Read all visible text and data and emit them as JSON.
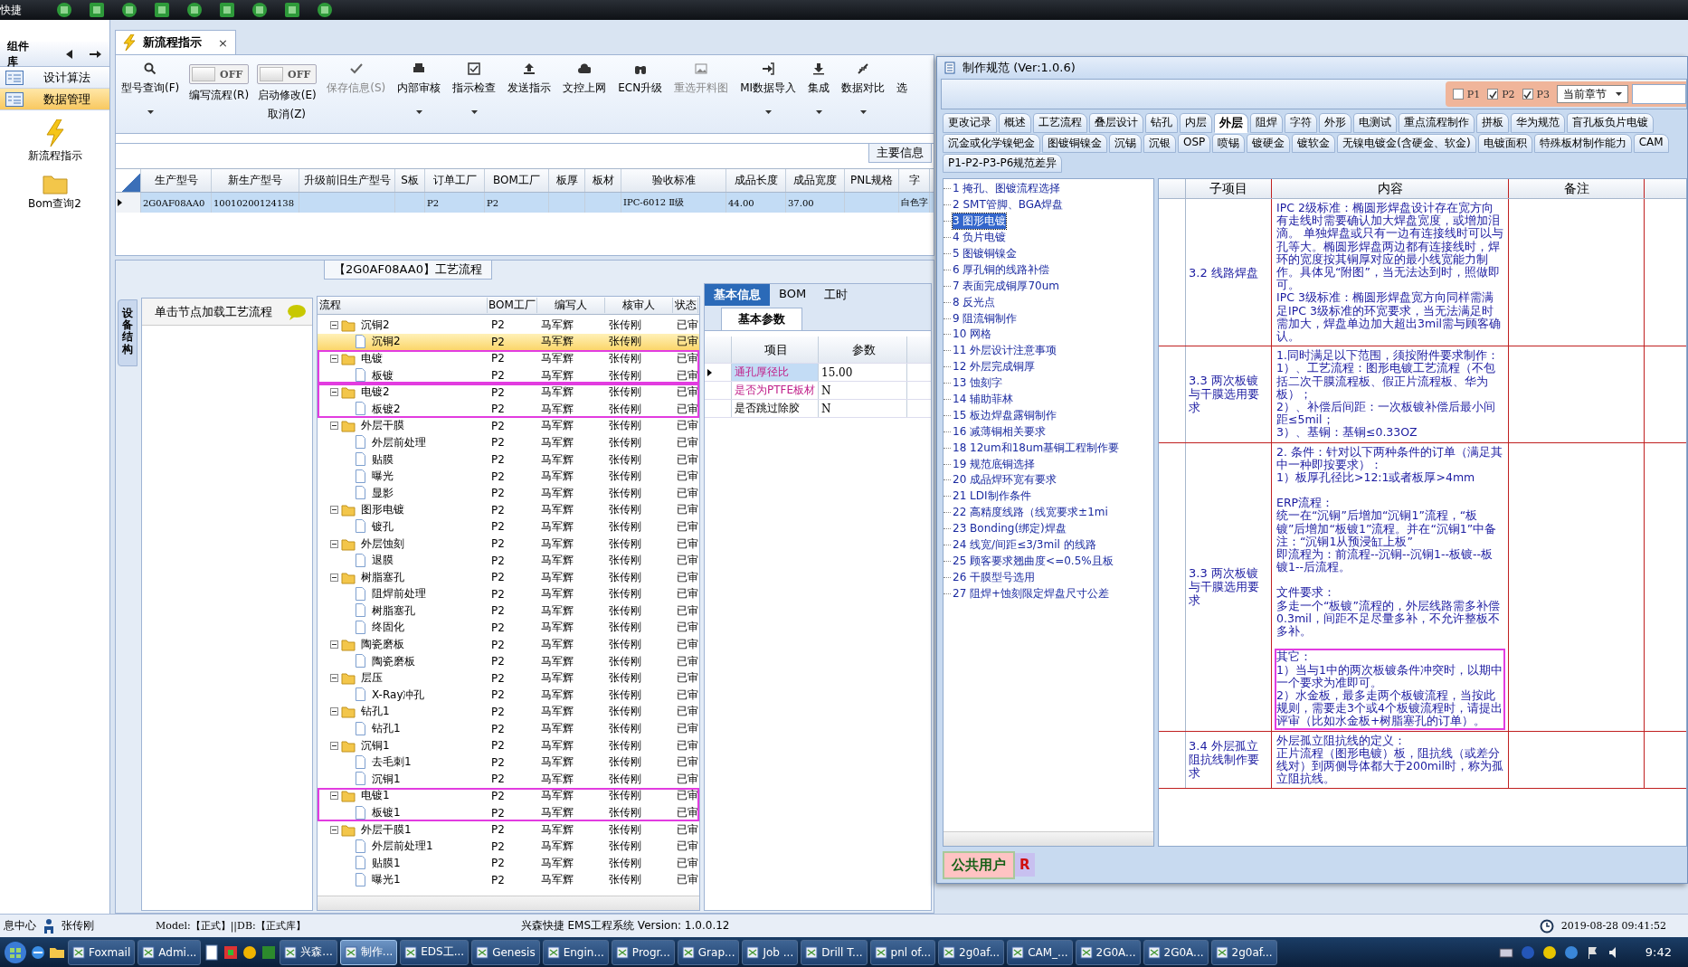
{
  "quickbar": {
    "title": "快捷"
  },
  "leftnav": {
    "title": "组件库",
    "items": [
      {
        "label": "设计算法",
        "selected": false
      },
      {
        "label": "数据管理",
        "selected": true
      }
    ],
    "shortcuts": [
      {
        "label": "新流程指示"
      },
      {
        "label": "Bom查询2"
      }
    ]
  },
  "doc_tab": {
    "label": "新流程指示",
    "selected": true,
    "close": "×"
  },
  "toolbar": [
    {
      "kind": "button",
      "lines": [
        "型号查询(F)"
      ],
      "disabled": false,
      "menu": true
    },
    {
      "kind": "toggle",
      "state_text": "OFF",
      "on": false,
      "lines": [
        "编写流程(R)"
      ]
    },
    {
      "kind": "toggle",
      "state_text": "OFF",
      "on": false,
      "lines": [
        "启动修改(E)",
        "取消(Z)"
      ]
    },
    {
      "kind": "button",
      "lines": [
        "保存信息(S)"
      ],
      "disabled": true,
      "menu": false
    },
    {
      "kind": "button",
      "lines": [
        "内部审核"
      ],
      "disabled": false,
      "menu": true
    },
    {
      "kind": "button",
      "lines": [
        "指示检查"
      ],
      "disabled": false,
      "menu": true
    },
    {
      "kind": "button",
      "lines": [
        "发送指示"
      ],
      "disabled": false,
      "menu": false
    },
    {
      "kind": "button",
      "lines": [
        "文控上网"
      ],
      "disabled": false,
      "menu": false
    },
    {
      "kind": "button",
      "lines": [
        "ECN升级"
      ],
      "disabled": false,
      "menu": false
    },
    {
      "kind": "button",
      "lines": [
        "重选开料图"
      ],
      "disabled": true,
      "menu": false
    },
    {
      "kind": "button",
      "lines": [
        "MI数据导入"
      ],
      "disabled": false,
      "menu": true
    },
    {
      "kind": "button",
      "lines": [
        "集成"
      ],
      "disabled": false,
      "menu": true
    },
    {
      "kind": "button",
      "lines": [
        "数据对比"
      ],
      "disabled": false,
      "menu": true
    },
    {
      "kind": "button",
      "lines": [
        "选"
      ],
      "disabled": false,
      "menu": false
    }
  ],
  "main_grid": {
    "tab": "主要信息",
    "columns": [
      "生产型号",
      "新生产型号",
      "升级前旧生产型号",
      "S板",
      "订单工厂",
      "BOM工厂",
      "板厚",
      "板材",
      "验收标准",
      "成品长度",
      "成品宽度",
      "PNL规格",
      "字"
    ],
    "rows": [
      {
        "selected": true,
        "cells": [
          "2G0AF08AA0",
          "10010200124138",
          "",
          "",
          "P2",
          "P2",
          "",
          "",
          "IPC-6012 Ⅱ级",
          "44.00",
          "37.00",
          "",
          "白色字"
        ]
      }
    ]
  },
  "flow_panel": {
    "title": "【2G0AF08AA0】工艺流程",
    "side_tab": "设备结构",
    "hint": "单击节点加载工艺流程"
  },
  "flow_tree": {
    "columns": [
      "流程",
      "BOM工厂",
      "编写人",
      "核审人",
      "状态"
    ],
    "nodes": [
      {
        "label": "沉铜2",
        "bom": "P2",
        "writer": "马军辉",
        "reviewer": "张传刚",
        "status": "已审",
        "expanded": true,
        "selected": false,
        "highlighted": false,
        "children": [
          {
            "label": "沉铜2",
            "bom": "P2",
            "writer": "马军辉",
            "reviewer": "张传刚",
            "status": "已审",
            "selected": true
          }
        ]
      },
      {
        "label": "电镀",
        "bom": "P2",
        "writer": "马军辉",
        "reviewer": "张传刚",
        "status": "已审",
        "expanded": true,
        "selected": false,
        "highlighted": true,
        "children": [
          {
            "label": "板镀",
            "bom": "P2",
            "writer": "马军辉",
            "reviewer": "张传刚",
            "status": "已审",
            "selected": false
          }
        ]
      },
      {
        "label": "电镀2",
        "bom": "P2",
        "writer": "马军辉",
        "reviewer": "张传刚",
        "status": "已审",
        "expanded": true,
        "selected": false,
        "highlighted": true,
        "children": [
          {
            "label": "板镀2",
            "bom": "P2",
            "writer": "马军辉",
            "reviewer": "张传刚",
            "status": "已审",
            "selected": false
          }
        ]
      },
      {
        "label": "外层干膜",
        "bom": "P2",
        "writer": "马军辉",
        "reviewer": "张传刚",
        "status": "已审",
        "expanded": true,
        "selected": false,
        "highlighted": false,
        "children": [
          {
            "label": "外层前处理",
            "bom": "P2",
            "writer": "马军辉",
            "reviewer": "张传刚",
            "status": "已审",
            "selected": false
          },
          {
            "label": "贴膜",
            "bom": "P2",
            "writer": "马军辉",
            "reviewer": "张传刚",
            "status": "已审",
            "selected": false
          },
          {
            "label": "曝光",
            "bom": "P2",
            "writer": "马军辉",
            "reviewer": "张传刚",
            "status": "已审",
            "selected": false
          },
          {
            "label": "显影",
            "bom": "P2",
            "writer": "马军辉",
            "reviewer": "张传刚",
            "status": "已审",
            "selected": false
          }
        ]
      },
      {
        "label": "图形电镀",
        "bom": "P2",
        "writer": "马军辉",
        "reviewer": "张传刚",
        "status": "已审",
        "expanded": true,
        "selected": false,
        "highlighted": false,
        "children": [
          {
            "label": "镀孔",
            "bom": "P2",
            "writer": "马军辉",
            "reviewer": "张传刚",
            "status": "已审",
            "selected": false
          }
        ]
      },
      {
        "label": "外层蚀刻",
        "bom": "P2",
        "writer": "马军辉",
        "reviewer": "张传刚",
        "status": "已审",
        "expanded": true,
        "selected": false,
        "highlighted": false,
        "children": [
          {
            "label": "退膜",
            "bom": "P2",
            "writer": "马军辉",
            "reviewer": "张传刚",
            "status": "已审",
            "selected": false
          }
        ]
      },
      {
        "label": "树脂塞孔",
        "bom": "P2",
        "writer": "马军辉",
        "reviewer": "张传刚",
        "status": "已审",
        "expanded": true,
        "selected": false,
        "highlighted": false,
        "children": [
          {
            "label": "阻焊前处理",
            "bom": "P2",
            "writer": "马军辉",
            "reviewer": "张传刚",
            "status": "已审",
            "selected": false
          },
          {
            "label": "树脂塞孔",
            "bom": "P2",
            "writer": "马军辉",
            "reviewer": "张传刚",
            "status": "已审",
            "selected": false
          },
          {
            "label": "终固化",
            "bom": "P2",
            "writer": "马军辉",
            "reviewer": "张传刚",
            "status": "已审",
            "selected": false
          }
        ]
      },
      {
        "label": "陶瓷磨板",
        "bom": "P2",
        "writer": "马军辉",
        "reviewer": "张传刚",
        "status": "已审",
        "expanded": true,
        "selected": false,
        "highlighted": false,
        "children": [
          {
            "label": "陶瓷磨板",
            "bom": "P2",
            "writer": "马军辉",
            "reviewer": "张传刚",
            "status": "已审",
            "selected": false
          }
        ]
      },
      {
        "label": "层压",
        "bom": "P2",
        "writer": "马军辉",
        "reviewer": "张传刚",
        "status": "已审",
        "expanded": true,
        "selected": false,
        "highlighted": false,
        "children": [
          {
            "label": "X-Ray冲孔",
            "bom": "P2",
            "writer": "马军辉",
            "reviewer": "张传刚",
            "status": "已审",
            "selected": false
          }
        ]
      },
      {
        "label": "钻孔1",
        "bom": "P2",
        "writer": "马军辉",
        "reviewer": "张传刚",
        "status": "已审",
        "expanded": true,
        "selected": false,
        "highlighted": false,
        "children": [
          {
            "label": "钻孔1",
            "bom": "P2",
            "writer": "马军辉",
            "reviewer": "张传刚",
            "status": "已审",
            "selected": false
          }
        ]
      },
      {
        "label": "沉铜1",
        "bom": "P2",
        "writer": "马军辉",
        "reviewer": "张传刚",
        "status": "已审",
        "expanded": true,
        "selected": false,
        "highlighted": false,
        "children": [
          {
            "label": "去毛刺1",
            "bom": "P2",
            "writer": "马军辉",
            "reviewer": "张传刚",
            "status": "已审",
            "selected": false
          },
          {
            "label": "沉铜1",
            "bom": "P2",
            "writer": "马军辉",
            "reviewer": "张传刚",
            "status": "已审",
            "selected": false
          }
        ]
      },
      {
        "label": "电镀1",
        "bom": "P2",
        "writer": "马军辉",
        "reviewer": "张传刚",
        "status": "已审",
        "expanded": true,
        "selected": false,
        "highlighted": true,
        "children": [
          {
            "label": "板镀1",
            "bom": "P2",
            "writer": "马军辉",
            "reviewer": "张传刚",
            "status": "已审",
            "selected": false
          }
        ]
      },
      {
        "label": "外层干膜1",
        "bom": "P2",
        "writer": "马军辉",
        "reviewer": "张传刚",
        "status": "已审",
        "expanded": true,
        "selected": false,
        "highlighted": false,
        "children": [
          {
            "label": "外层前处理1",
            "bom": "P2",
            "writer": "马军辉",
            "reviewer": "张传刚",
            "status": "已审",
            "selected": false
          },
          {
            "label": "贴膜1",
            "bom": "P2",
            "writer": "马军辉",
            "reviewer": "张传刚",
            "status": "已审",
            "selected": false
          },
          {
            "label": "曝光1",
            "bom": "P2",
            "writer": "马军辉",
            "reviewer": "张传刚",
            "status": "已审",
            "selected": false
          }
        ]
      }
    ]
  },
  "props": {
    "tabs": [
      {
        "label": "基本信息",
        "selected": true
      },
      {
        "label": "BOM",
        "selected": false
      },
      {
        "label": "工时",
        "selected": false
      }
    ],
    "subtab": "基本参数",
    "columns": [
      "项目",
      "参数"
    ],
    "rows": [
      {
        "item": "通孔厚径比",
        "value": "15.00",
        "emphasized": true,
        "selected": true
      },
      {
        "item": "是否为PTFE板材",
        "value": "N",
        "emphasized": true,
        "selected": false
      },
      {
        "item": "是否跳过除胶",
        "value": "N",
        "emphasized": false,
        "selected": false
      }
    ]
  },
  "spec_window": {
    "title": "制作规范 (Ver:1.0.6)",
    "filters": [
      {
        "label": "P1",
        "checked": false
      },
      {
        "label": "P2",
        "checked": true
      },
      {
        "label": "P3",
        "checked": true
      }
    ],
    "scope": "当前章节",
    "tab_rows": [
      [
        {
          "label": "更改记录",
          "selected": false
        },
        {
          "label": "概述",
          "selected": false
        },
        {
          "label": "工艺流程",
          "selected": false
        },
        {
          "label": "叠层设计",
          "selected": false
        },
        {
          "label": "钻孔",
          "selected": false
        },
        {
          "label": "内层",
          "selected": false
        },
        {
          "label": "外层",
          "selected": true
        },
        {
          "label": "阻焊",
          "selected": false
        },
        {
          "label": "字符",
          "selected": false
        },
        {
          "label": "外形",
          "selected": false
        },
        {
          "label": "电测试",
          "selected": false
        },
        {
          "label": "重点流程制作",
          "selected": false
        },
        {
          "label": "拼板",
          "selected": false
        },
        {
          "label": "华为规范",
          "selected": false
        },
        {
          "label": "盲孔板负片电镀",
          "selected": false
        }
      ],
      [
        {
          "label": "沉金或化学镍钯金",
          "selected": false
        },
        {
          "label": "图镀铜镍金",
          "selected": false
        },
        {
          "label": "沉锡",
          "selected": false
        },
        {
          "label": "沉银",
          "selected": false
        },
        {
          "label": "OSP",
          "selected": false
        },
        {
          "label": "喷锡",
          "selected": false
        },
        {
          "label": "镀硬金",
          "selected": false
        },
        {
          "label": "镀软金",
          "selected": false
        },
        {
          "label": "无镍电镀金(含硬金、软金)",
          "selected": false
        },
        {
          "label": "电镀面积",
          "selected": false
        },
        {
          "label": "特殊板材制作能力",
          "selected": false
        },
        {
          "label": "CAM",
          "selected": false
        }
      ],
      [
        {
          "label": "P1-P2-P3-P6规范差异",
          "selected": false
        }
      ]
    ],
    "sections": [
      {
        "label": "1 掩孔、图镀流程选择",
        "selected": false
      },
      {
        "label": "2 SMT管脚、BGA焊盘",
        "selected": false
      },
      {
        "label": "3 图形电镀",
        "selected": true
      },
      {
        "label": "4 负片电镀",
        "selected": false
      },
      {
        "label": "5 图镀铜镍金",
        "selected": false
      },
      {
        "label": "6 厚孔铜的线路补偿",
        "selected": false
      },
      {
        "label": "7 表面完成铜厚70um",
        "selected": false
      },
      {
        "label": "8 反光点",
        "selected": false
      },
      {
        "label": "9 阻流铜制作",
        "selected": false
      },
      {
        "label": "10 网格",
        "selected": false
      },
      {
        "label": "11 外层设计注意事项",
        "selected": false
      },
      {
        "label": "12 外层完成铜厚",
        "selected": false
      },
      {
        "label": "13 蚀刻字",
        "selected": false
      },
      {
        "label": "14 辅助菲林",
        "selected": false
      },
      {
        "label": "15 板边焊盘露铜制作",
        "selected": false
      },
      {
        "label": "16 减薄铜相关要求",
        "selected": false
      },
      {
        "label": "18 12um和18um基铜工程制作要",
        "selected": false
      },
      {
        "label": "19 规范底铜选择",
        "selected": false
      },
      {
        "label": "20 成品焊环宽有要求",
        "selected": false
      },
      {
        "label": "21 LDI制作条件",
        "selected": false
      },
      {
        "label": "22 高精度线路（线宽要求±1mi",
        "selected": false
      },
      {
        "label": "23 Bonding(绑定)焊盘",
        "selected": false
      },
      {
        "label": "24 线宽/间距≤3/3mil 的线路",
        "selected": false
      },
      {
        "label": "25 顾客要求翘曲度<=0.5%且板",
        "selected": false
      },
      {
        "label": "26 干膜型号选用",
        "selected": false
      },
      {
        "label": "27 阻焊+蚀刻限定焊盘尺寸公差",
        "selected": false
      }
    ],
    "table": {
      "columns": [
        "子项目",
        "内容",
        "备注"
      ],
      "rows": [
        {
          "item": "3.2 线路焊盘",
          "remark": "",
          "sections": [
            {
              "highlighted": false,
              "paragraphs": [
                "IPC 2级标准：椭圆形焊盘设计存在宽方向有走线时需要确认加大焊盘宽度，或增加泪滴。 单独焊盘或只有一边有连接线时可以与孔等大。椭圆形焊盘两边都有连接线时，焊环的宽度按其铜厚对应的最小线宽能力制作。具体见“附图”，当无法达到时，照做即可。",
                "IPC 3级标准：椭圆形焊盘宽方向同样需满足IPC 3级标准的环宽要求，当无法满足时需加大，焊盘单边加大超出3mil需与顾客确认。"
              ]
            }
          ]
        },
        {
          "item": "3.3 两次板镀与干膜选用要求",
          "sections": [
            {
              "highlighted": false,
              "paragraphs": [
                "1.同时满足以下范围，须按附件要求制作：",
                "1）、工艺流程：图形电镀工艺流程（不包括二次干膜流程板、假正片流程板、华为板）；",
                "2）、补偿后间距：一次板镀补偿后最小间距≤5mil；",
                "3）、基铜：基铜≤0.33OZ"
              ]
            }
          ]
        },
        {
          "item": "3.3 两次板镀与干膜选用要求",
          "sections": [
            {
              "highlighted": false,
              "paragraphs": [
                "2. 条件：针对以下两种条件的订单（满足其中一种即按要求）：",
                "1）板厚孔径比>12:1或者板厚>4mm"
              ]
            },
            {
              "highlighted": false,
              "paragraphs": [
                "ERP流程：",
                "统一在“沉铜”后增加“沉铜1”流程，“板镀”后增加“板镀1”流程。并在“沉铜1”中备注：“沉铜1从预浸缸上板”",
                "即流程为：前流程--沉铜--沉铜1--板镀--板镀1--后流程。"
              ]
            },
            {
              "highlighted": false,
              "paragraphs": [
                "文件要求：",
                "多走一个“板镀”流程的，外层线路需多补偿0.3mil，间距不足尽量多补，不允许整板不多补。"
              ]
            },
            {
              "highlighted": true,
              "paragraphs": [
                "其它：",
                "1）当与1中的两次板镀条件冲突时，以期中一个要求为准即可。",
                "2）水金板，最多走两个板镀流程，当按此规则，需要走3个或4个板镀流程时，请提出评审（比如水金板+树脂塞孔的订单）。"
              ]
            }
          ]
        },
        {
          "item": "3.4 外层孤立阻抗线制作要求",
          "sections": [
            {
              "highlighted": false,
              "paragraphs": [
                "外层孤立阻抗线的定义：",
                "正片流程（图形电镀）板，阻抗线（或差分线对）到两侧导体都大于200mil时，称为孤立阻抗线。"
              ]
            }
          ]
        }
      ]
    },
    "user": "公共用户",
    "role": "R"
  },
  "status_bar": {
    "left": "息中心",
    "user": "张传刚",
    "model": "Model:【正式】||DB:【正式库】",
    "app": "兴森快捷 EMS工程系统 Version: 1.0.0.12",
    "time": "2019-08-28 09:41:52"
  },
  "taskbar": {
    "buttons": [
      {
        "label": "Foxmail",
        "selected": false
      },
      {
        "label": "Admi...",
        "selected": false
      },
      {
        "label": "兴森...",
        "selected": false
      },
      {
        "label": "制作...",
        "selected": true
      },
      {
        "label": "EDS工...",
        "selected": false
      },
      {
        "label": "Genesis",
        "selected": false
      },
      {
        "label": "Engin...",
        "selected": false
      },
      {
        "label": "Progr...",
        "selected": false
      },
      {
        "label": "Grap...",
        "selected": false
      },
      {
        "label": "Job ...",
        "selected": false
      },
      {
        "label": "Drill T...",
        "selected": false
      },
      {
        "label": "pnl of...",
        "selected": false
      },
      {
        "label": "2g0af...",
        "selected": false
      },
      {
        "label": "CAM_...",
        "selected": false
      },
      {
        "label": "2G0A...",
        "selected": false
      },
      {
        "label": "2G0A...",
        "selected": false
      },
      {
        "label": "2g0af...",
        "selected": false
      }
    ],
    "clock": "9:42"
  }
}
